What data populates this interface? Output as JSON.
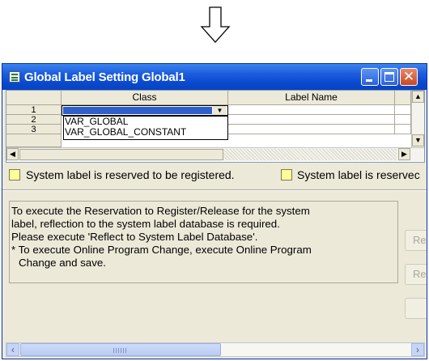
{
  "window": {
    "title": "Global Label Setting Global1"
  },
  "grid": {
    "columns": [
      "",
      "Class",
      "Label Name"
    ],
    "row_numbers": [
      "1",
      "2",
      "3"
    ],
    "class_dropdown_options": [
      "VAR_GLOBAL",
      "VAR_GLOBAL_CONSTANT"
    ]
  },
  "legend": {
    "item1": "System label is reserved to be registered.",
    "item2": "System label is reservec"
  },
  "message": {
    "lines": [
      "To execute the Reservation to Register/Release for the system",
      "label, reflection to the system label database is required.",
      "Please execute 'Reflect to System Label Database'.",
      "* To execute Online Program Change, execute Online Program",
      "Change and save."
    ]
  },
  "side_buttons": [
    "Re",
    "Re",
    ""
  ],
  "colors": {
    "titlebar": "#0a4ad0",
    "selection": "#2e5fcc",
    "legend_swatch": "#ffff99",
    "window_face": "#ece9d8"
  },
  "icons": [
    "down-arrow-icon",
    "app-icon",
    "minimize-icon",
    "maximize-icon",
    "close-icon"
  ]
}
